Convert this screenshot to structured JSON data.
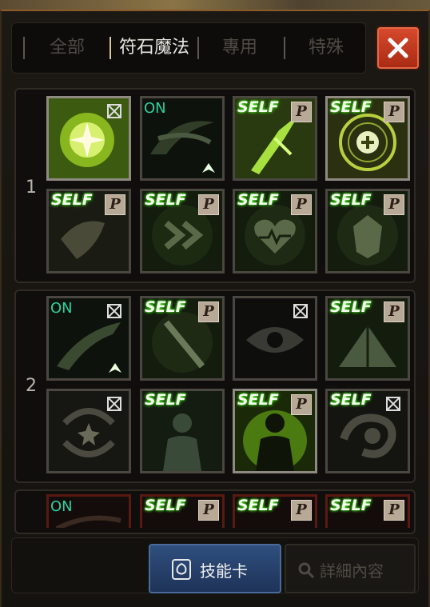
{
  "tabs": [
    {
      "label": "全部",
      "active": false
    },
    {
      "label": "符石魔法",
      "active": true
    },
    {
      "label": "專用",
      "active": false
    },
    {
      "label": "特殊",
      "active": false
    }
  ],
  "groups": [
    {
      "number": "1",
      "skills": [
        {
          "name": "burst-skill-icon",
          "badge": "lock",
          "up": false
        },
        {
          "name": "wind-slash-skill-icon",
          "badge": "ON",
          "up": true
        },
        {
          "name": "blade-skill-icon",
          "badge": "SELF",
          "passive": "P"
        },
        {
          "name": "heal-circle-skill-icon",
          "badge": "SELF",
          "passive": "P"
        },
        {
          "name": "shield-skill-icon",
          "badge": "SELF",
          "passive": "P"
        },
        {
          "name": "haste-skill-icon",
          "badge": "SELF",
          "passive": "P"
        },
        {
          "name": "heart-skill-icon",
          "badge": "SELF",
          "passive": "P"
        },
        {
          "name": "armor-skill-icon",
          "badge": "SELF",
          "passive": "P"
        }
      ]
    },
    {
      "number": "2",
      "skills": [
        {
          "name": "dash-skill-icon",
          "badge": "ON",
          "lock": true,
          "up": true
        },
        {
          "name": "sword-skill-icon",
          "badge": "SELF",
          "passive": "P"
        },
        {
          "name": "eye-skill-icon",
          "badge": "lock"
        },
        {
          "name": "camp-skill-icon",
          "badge": "SELF",
          "passive": "P"
        },
        {
          "name": "star-cycle-skill-icon",
          "badge": "lock"
        },
        {
          "name": "figure-skill-icon",
          "badge": "SELF"
        },
        {
          "name": "aura-figure-skill-icon",
          "badge": "SELF",
          "passive": "P"
        },
        {
          "name": "chameleon-skill-icon",
          "badge": "SELF",
          "lock": true
        }
      ]
    },
    {
      "number": "",
      "skills": [
        {
          "name": "partial-skill-icon",
          "badge": "ON"
        },
        {
          "name": "partial-skill-icon",
          "badge": "SELF",
          "passive": "P"
        },
        {
          "name": "partial-skill-icon",
          "badge": "SELF",
          "passive": "P"
        },
        {
          "name": "partial-skill-icon",
          "badge": "SELF",
          "passive": "P"
        }
      ]
    }
  ],
  "labels": {
    "on": "ON",
    "self": "SELF",
    "p": "P"
  },
  "buttons": {
    "skill_cards": "技能卡",
    "details": "詳細內容"
  },
  "colors": {
    "accent_green": "#4cff20",
    "on_text": "#2ed0a0",
    "close_red": "#c83a1e",
    "primary_blue": "#2a4a7a"
  }
}
